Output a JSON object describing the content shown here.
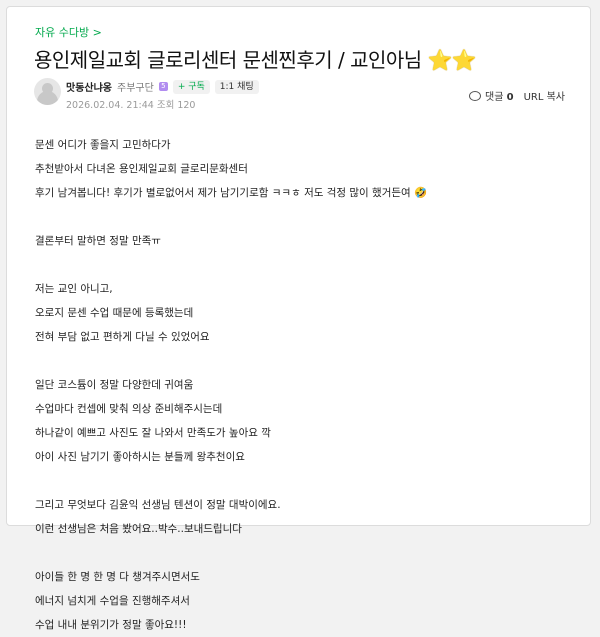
{
  "breadcrumb": "자유 수다방 >",
  "title": "용인제일교회 글로리센터 문센찐후기 / 교인아님",
  "title_emoji": "⭐⭐",
  "author": {
    "name": "맛동산냐옹",
    "rank": "주부구단",
    "rank_badge": "5",
    "subscribe_label": "+ 구독",
    "chat_label": "1:1 채팅",
    "date": "2026.02.04. 21:44",
    "views": "조회 120"
  },
  "actions": {
    "comment_label": "댓글",
    "comment_count": "0",
    "url_copy_label": "URL 복사",
    "more_label": "⋮"
  },
  "body_lines": [
    "문센 어디가 좋을지 고민하다가",
    "추천받아서 다녀온 용인제일교회 글로리문화센터",
    "후기 남겨봅니다! 후기가 별로없어서 제가 남기기로함 ㅋㅋㅎ 저도 걱정 많이 했거든여 🤣",
    "",
    "결론부터 말하면 정말 만족ㅠ",
    "",
    "저는 교인 아니고,",
    "오로지 문센 수업 때문에 등록했는데",
    "전혀 부담 없고 편하게 다닐 수 있었어요",
    "",
    "일단 코스튬이 정말 다양한데 귀여움",
    "수업마다 컨셉에 맞춰 의상 준비해주시는데",
    "하나같이 예쁘고 사진도 잘 나와서 만족도가 높아요 깍",
    "아이 사진 남기기 좋아하시는 분들께 왕추천이요",
    "",
    "그리고 무엇보다 김윤익 선생님 텐션이 정말 대박이에요.",
    "이런 선생님은 처음 봤어요..박수..보내드립니다",
    "",
    "아이들 한 명 한 명 다 챙겨주시면서도",
    "에너지 넘치게 수업을 진행해주셔서",
    "수업 내내 분위기가 정말 좋아요!!!"
  ]
}
